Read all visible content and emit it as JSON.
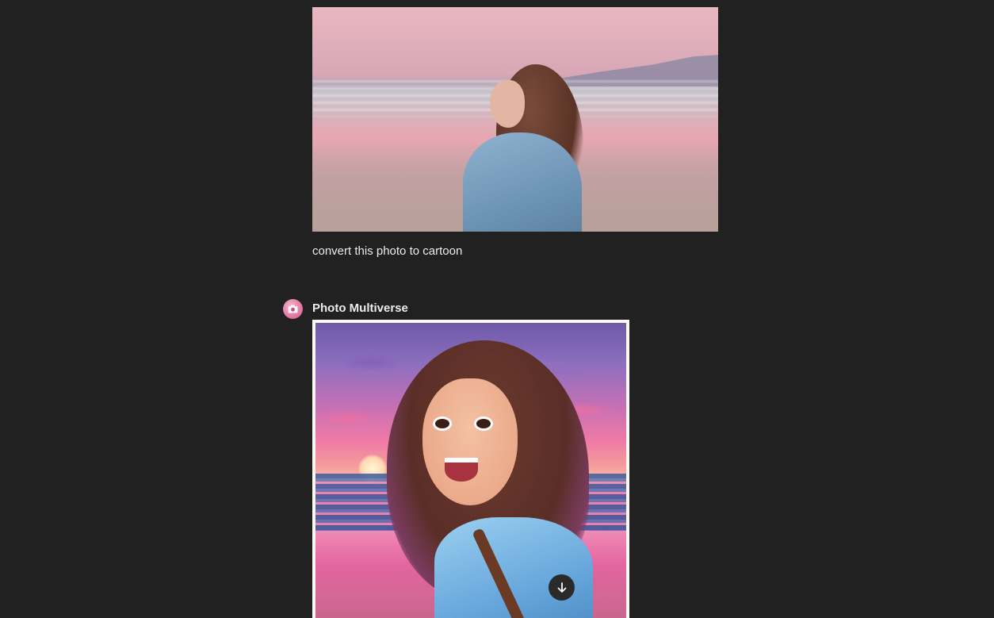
{
  "conversation": {
    "user_message": {
      "image_alt": "user uploaded photo",
      "text": "convert this photo to cartoon"
    },
    "assistant_message": {
      "name": "Photo Multiverse",
      "avatar_icon": "camera-icon",
      "image_alt": "cartoon version of the photo",
      "download_icon": "arrow-down-icon"
    }
  },
  "colors": {
    "background": "#212121",
    "text": "#ececec",
    "avatar_accent": "#e27aa4",
    "download_button": "#2a2a2a"
  }
}
